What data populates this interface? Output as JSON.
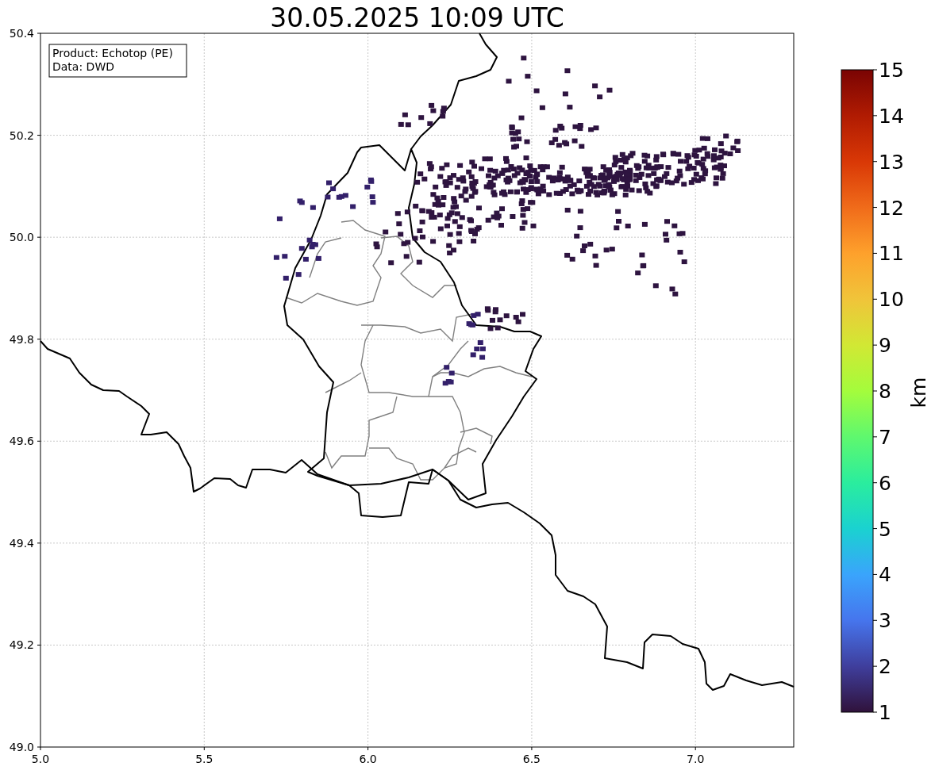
{
  "title": "30.05.2025 10:09 UTC",
  "info_box": [
    "Product: Echotop (PE)",
    "Data: DWD"
  ],
  "map": {
    "xticks": [
      "5.0",
      "5.5",
      "6.0",
      "6.5",
      "7.0"
    ],
    "yticks": [
      "50.4",
      "50.2",
      "50.0",
      "49.8",
      "49.6",
      "49.4",
      "49.2",
      "49.0"
    ]
  },
  "colorbar": {
    "label": "km",
    "ticks": [
      "15",
      "14",
      "13",
      "12",
      "11",
      "10",
      "9",
      "8",
      "7",
      "6",
      "5",
      "4",
      "3",
      "2",
      "1"
    ]
  }
}
